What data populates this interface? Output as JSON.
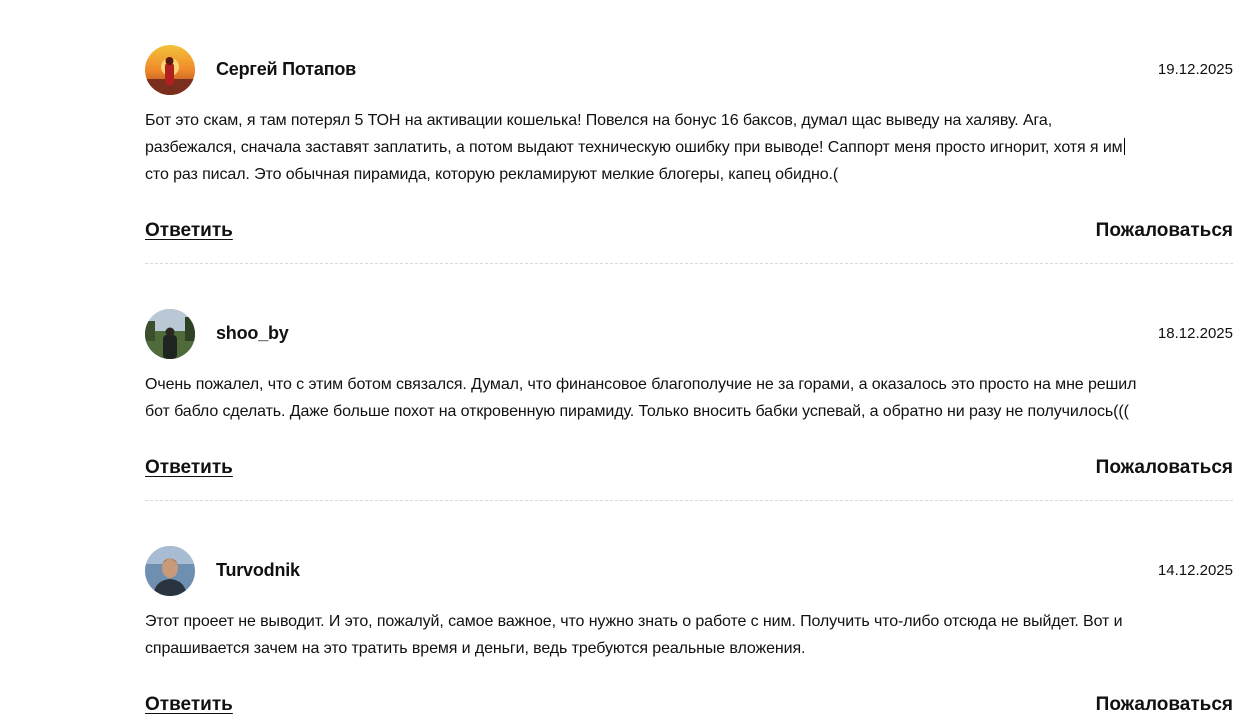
{
  "comments": [
    {
      "author": "Сергей Потапов",
      "date": "19.12.2025",
      "avatar_icon": "sunset-person-avatar",
      "text_lines": [
        "Бот это скам, я там потерял 5 ТОН на активации кошелька! Повелся на бонус 16 баксов, думал щас выведу на халяву. Ага,",
        "разбежался, сначала заставят заплатить, а потом выдают техническую ошибку при выводе! Саппорт меня просто игнорит, хотя я им",
        "сто раз писал. Это обычная пирамида, которую рекламируют мелкие блогеры, капец обидно.("
      ],
      "reply_label": "Ответить",
      "report_label": "Пожаловаться"
    },
    {
      "author": "shoo_by",
      "date": "18.12.2025",
      "avatar_icon": "park-person-avatar",
      "text_lines": [
        "Очень пожалел, что с этим ботом связался. Думал, что финансовое благополучие не за горами, а оказалось это просто на мне решил",
        "бот бабло сделать. Даже больше похот на откровенную пирамиду. Только вносить бабки успевай, а обратно ни разу не получилось((("
      ],
      "reply_label": "Ответить",
      "report_label": "Пожаловаться"
    },
    {
      "author": "Turvodnik",
      "date": "14.12.2025",
      "avatar_icon": "man-portrait-avatar",
      "text_lines": [
        "Этот проеет не выводит. И это, пожалуй, самое важное, что нужно знать о работе с ним. Получить что-либо отсюда не выйдет. Вот и",
        "спрашивается зачем на это тратить время и деньги, ведь требуются реальные вложения."
      ],
      "reply_label": "Ответить",
      "report_label": "Пожаловаться"
    }
  ]
}
